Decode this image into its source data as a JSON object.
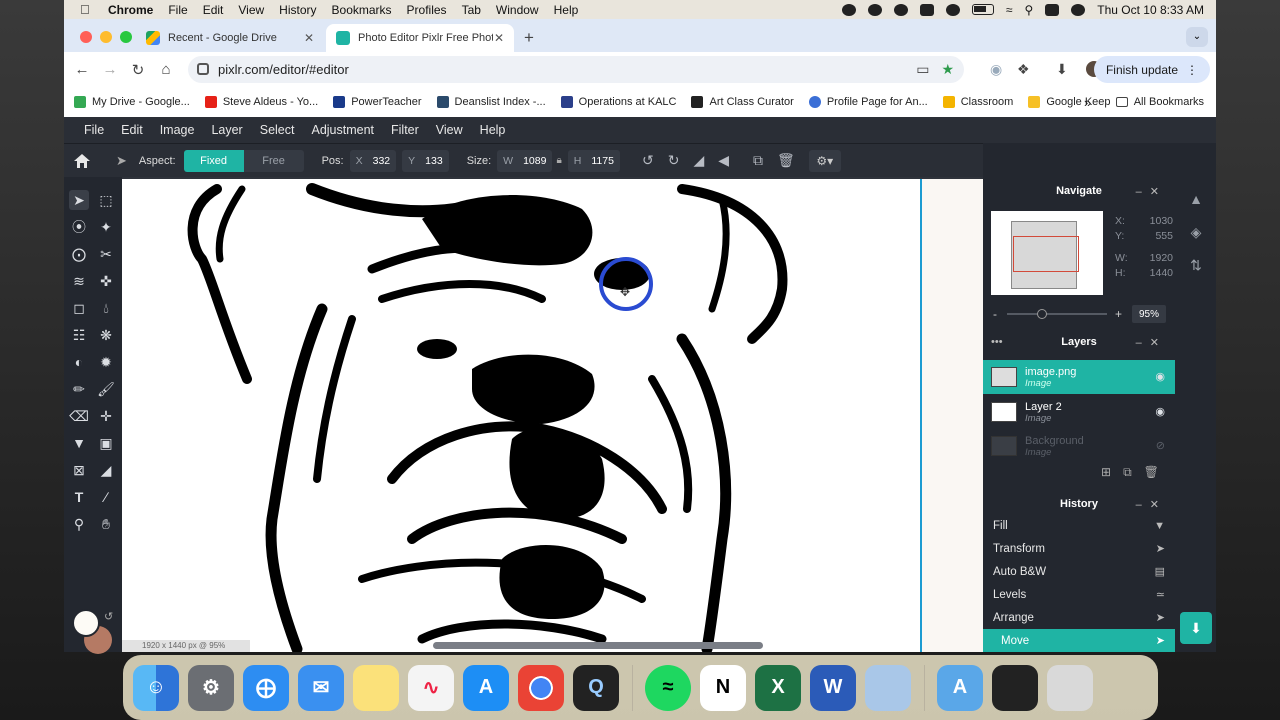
{
  "menubar": {
    "app": "Chrome",
    "items": [
      "File",
      "Edit",
      "View",
      "History",
      "Bookmarks",
      "Profiles",
      "Tab",
      "Window",
      "Help"
    ],
    "clock": "Thu Oct 10  8:33 AM"
  },
  "browser": {
    "tabs": [
      {
        "title": "Recent - Google Drive",
        "active": false
      },
      {
        "title": "Photo Editor Pixlr Free Photos",
        "active": true
      }
    ],
    "url": "pixlr.com/editor/#editor",
    "finish_update": "Finish update",
    "bookmarks": [
      {
        "label": "My Drive - Google...",
        "color": "#34a853"
      },
      {
        "label": "Steve Aldeus - Yo...",
        "color": "#e62117"
      },
      {
        "label": "PowerTeacher",
        "color": "#1a3a8a"
      },
      {
        "label": "Deanslist Index -...",
        "color": "#2b4a6b"
      },
      {
        "label": "Operations at KALC",
        "color": "#2b3f8a"
      },
      {
        "label": "Art Class Curator",
        "color": "#222222"
      },
      {
        "label": "Profile Page for An...",
        "color": "#3b6fd6"
      },
      {
        "label": "Classroom",
        "color": "#f4b400"
      },
      {
        "label": "Google Keep",
        "color": "#f6c026"
      }
    ],
    "bookmarks_more": "»",
    "all_bookmarks": "All Bookmarks"
  },
  "pixlr": {
    "menu": [
      "File",
      "Edit",
      "Image",
      "Layer",
      "Select",
      "Adjustment",
      "Filter",
      "View",
      "Help"
    ],
    "options": {
      "aspect_label": "Aspect:",
      "fixed": "Fixed",
      "free": "Free",
      "pos_label": "Pos:",
      "x_label": "X",
      "x_value": "332",
      "y_label": "Y",
      "y_value": "133",
      "size_label": "Size:",
      "w_label": "W",
      "w_value": "1089",
      "h_label": "H",
      "h_value": "1175"
    },
    "status": "1920 x 1440 px @ 95%",
    "navigate": {
      "title": "Navigate",
      "x_label": "X:",
      "x": "1030",
      "y_label": "Y:",
      "y": "555",
      "w_label": "W:",
      "w": "1920",
      "h_label": "H:",
      "h": "1440",
      "zoom_minus": "-",
      "zoom_plus": "+",
      "zoom_value": "95%",
      "zoom_fraction": 0.3
    },
    "layers": {
      "title": "Layers",
      "items": [
        {
          "name": "image.png",
          "type": "Image",
          "selected": true
        },
        {
          "name": "Layer 2",
          "type": "Image",
          "selected": false
        },
        {
          "name": "Background",
          "type": "Image",
          "selected": false,
          "hidden": true
        }
      ]
    },
    "history": {
      "title": "History",
      "items": [
        "Fill",
        "Transform",
        "Auto B&W",
        "Levels",
        "Arrange",
        "Move"
      ],
      "selected": "Move"
    },
    "accent": "#1fb4a4"
  }
}
